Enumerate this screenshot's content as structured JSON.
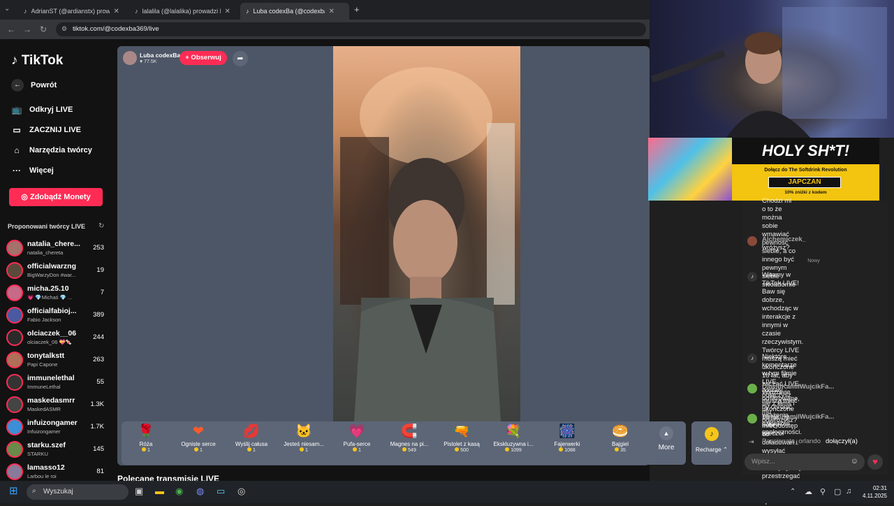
{
  "browser": {
    "tabs": [
      {
        "title": "AdrianST (@ardianstx) prowadzi",
        "active": false
      },
      {
        "title": "lalalila (@lalalika) prowadzi LIV",
        "active": false
      },
      {
        "title": "Luba codexBa (@codexba3",
        "active": true
      }
    ],
    "new_tab": "+",
    "url": "tiktok.com/@codexba369/live"
  },
  "sidebar": {
    "logo": "TikTok",
    "back": "Powrót",
    "nav": [
      "Odkryj LIVE",
      "ZACZNIJ LIVE",
      "Narzędzia twórcy",
      "Więcej"
    ],
    "coins_button": "Zdobądź Monety",
    "suggested_title": "Proponowani twórcy LIVE",
    "creators": [
      {
        "name": "natalia_chere...",
        "sub": "natalia_chereta",
        "count": "253"
      },
      {
        "name": "officialwarzng",
        "sub": "BigWarzyDon #war...",
        "count": "19"
      },
      {
        "name": "micha.25.10",
        "sub": "💗 💎Michaś 💎 ...",
        "count": "7"
      },
      {
        "name": "officialfabioj...",
        "sub": "Fabio Jackson",
        "count": "389"
      },
      {
        "name": "olciaczek__06",
        "sub": "olciaczek_06 💝🍬",
        "count": "244"
      },
      {
        "name": "tonytalkstt",
        "sub": "Papi Capone",
        "count": "263"
      },
      {
        "name": "immunelethal",
        "sub": "ImmuneLethal",
        "count": "55"
      },
      {
        "name": "maskedasmrr",
        "sub": "MaskedASMR",
        "count": "1.3K"
      },
      {
        "name": "infuizongamer",
        "sub": "Infuizongamer",
        "count": "1.7K"
      },
      {
        "name": "starku.szef",
        "sub": "STARKU",
        "count": "145"
      },
      {
        "name": "lamasso12",
        "sub": "Larbou le roi",
        "count": "81"
      }
    ]
  },
  "stream": {
    "host_name": "Luba codexBa",
    "likes": "77.5K",
    "follow": "+ Obserwuj",
    "recommended": "Polecane transmisje LIVE"
  },
  "gifts": [
    {
      "icon": "🌹",
      "name": "Róża",
      "price": "1"
    },
    {
      "icon": "❤",
      "name": "Ogniste serce",
      "price": "1"
    },
    {
      "icon": "💋",
      "name": "Wyślij całusa",
      "price": "1"
    },
    {
      "icon": "🐱",
      "name": "Jesteś niesam...",
      "price": "1"
    },
    {
      "icon": "💗",
      "name": "Pufa-serce",
      "price": "1"
    },
    {
      "icon": "🧲",
      "name": "Magnes na pi...",
      "price": "549"
    },
    {
      "icon": "🔫",
      "name": "Pistolet z kasą",
      "price": "500"
    },
    {
      "icon": "💐",
      "name": "Ekskluzywna i...",
      "price": "1099"
    },
    {
      "icon": "🎆",
      "name": "Fajerwerki",
      "price": "1088"
    },
    {
      "icon": "🥯",
      "name": "Bajgiel",
      "price": "35"
    }
  ],
  "gift_more": "More",
  "recharge": "Recharge",
  "ad": {
    "headline": "HOLY SH*T!",
    "sub": "Dołącz do The Softdrink Revolution",
    "code": "JAPCZAN",
    "discount": "10% zniżki z kodem"
  },
  "chat": {
    "top_text": "Chodzi mi o to że można sobie\nwmawiać pewność siebie, a co\ninnego być pewnym siebie\nswoadomie",
    "messages": [
      {
        "user": "Alchemiczek_",
        "text": "wróżysz?"
      },
      {
        "user": "",
        "text": "Witamy w TikTok LIVE! Baw się dobrze,\nwchodząc w interakcje z innymi w\nczasie rzeczywistym. Twórcy LIVE\nmuszą mieć ukończone 18 lat, aby\nzacząć LIVE. Widzowie muszą mieć\nukończone 18 lat, by mieć dostęp do\ndoładowań i wysyłać Prezenty.\nPamiętaj, aby przestrzegać naszych\nZasad społeczności."
      },
      {
        "user": "",
        "text": "Niektóre komentarze w tym filmie LIVE\nzostały odfiltrowane, by chronić\nwrażenia członków społeczności."
      },
      {
        "user": "DawidKamilWujcikFa...",
        "text": "połączysz się z kimś i mu\npowróżysz?"
      },
      {
        "user": "DawidKamilWujcikFa...",
        "text": "dobry wieczór"
      }
    ],
    "new_label": "Nowy",
    "join_user": "Passjonata_orlando",
    "join_text": "dołączył(a)",
    "input_placeholder": "Wpisz..."
  },
  "taskbar": {
    "search": "Wyszukaj",
    "time": "02:31",
    "date": "4.11.2025"
  }
}
